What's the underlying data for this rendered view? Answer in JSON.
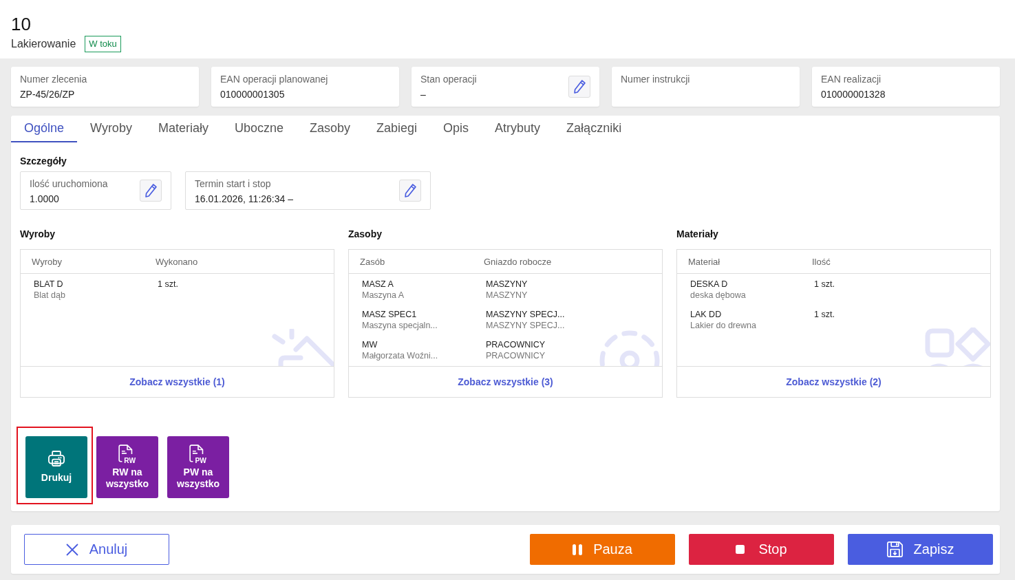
{
  "header": {
    "number": "10",
    "operation": "Lakierowanie",
    "status_badge": "W toku"
  },
  "info_fields": [
    {
      "label": "Numer zlecenia",
      "value": "ZP-45/26/ZP",
      "editable": false
    },
    {
      "label": "EAN operacji planowanej",
      "value": "010000001305",
      "editable": false
    },
    {
      "label": "Stan operacji",
      "value": "–",
      "editable": true
    },
    {
      "label": "Numer instrukcji",
      "editable": false
    },
    {
      "label": "EAN realizacji",
      "value": "010000001328",
      "editable": false
    }
  ],
  "tabs": [
    {
      "label": "Ogólne",
      "selected": true
    },
    {
      "label": "Wyroby",
      "selected": false
    },
    {
      "label": "Materiały",
      "selected": false
    },
    {
      "label": "Uboczne",
      "selected": false
    },
    {
      "label": "Zasoby",
      "selected": false
    },
    {
      "label": "Zabiegi",
      "selected": false
    },
    {
      "label": "Opis",
      "selected": false
    },
    {
      "label": "Atrybuty",
      "selected": false
    },
    {
      "label": "Załączniki",
      "selected": false
    }
  ],
  "details": {
    "title": "Szczegóły",
    "fields": [
      {
        "label": "Ilość uruchomiona",
        "value": "1.0000",
        "editable": true
      },
      {
        "label": "Termin start i stop",
        "value": "16.01.2026, 11:26:34 –",
        "editable": true
      }
    ]
  },
  "panels": [
    {
      "title": "Wyroby",
      "kind": "products",
      "columns": [
        "Wyroby",
        "Wykonano"
      ],
      "rows": [
        {
          "cells": [
            {
              "main": "BLAT D",
              "sub": "Blat dąb"
            },
            {
              "main": "1 szt."
            }
          ]
        }
      ],
      "link": "Zobacz wszystkie (1)"
    },
    {
      "title": "Zasoby",
      "kind": "resources",
      "columns": [
        "Zasób",
        "Gniazdo robocze"
      ],
      "rows": [
        {
          "cells": [
            {
              "main": "MASZ A",
              "sub": "Maszyna A"
            },
            {
              "main": "MASZYNY",
              "sub": "MASZYNY"
            }
          ]
        },
        {
          "cells": [
            {
              "main": "MASZ SPEC1",
              "sub": "Maszyna specjaln..."
            },
            {
              "main": "MASZYNY SPECJ...",
              "sub": "MASZYNY SPECJ..."
            }
          ]
        },
        {
          "cells": [
            {
              "main": "MW",
              "sub": "Małgorzata Woźni..."
            },
            {
              "main": "PRACOWNICY",
              "sub": "PRACOWNICY"
            }
          ]
        }
      ],
      "link": "Zobacz wszystkie (3)"
    },
    {
      "title": "Materiały",
      "kind": "materials",
      "columns": [
        "Materiał",
        "Ilość"
      ],
      "rows": [
        {
          "cells": [
            {
              "main": "DESKA D",
              "sub": "deska dębowa"
            },
            {
              "main": "1 szt."
            }
          ]
        },
        {
          "cells": [
            {
              "main": "LAK DD",
              "sub": "Lakier do drewna"
            },
            {
              "main": "1 szt."
            }
          ]
        }
      ],
      "link": "Zobacz wszystkie (2)"
    }
  ],
  "actions": [
    {
      "label": "Drukuj",
      "kind": "print",
      "highlighted": true
    },
    {
      "label": "RW na wszystko",
      "kind": "document",
      "icon_text": "RW",
      "highlighted": false
    },
    {
      "label": "PW na wszystko",
      "kind": "document",
      "icon_text": "PW",
      "highlighted": false
    }
  ],
  "footer_buttons": [
    {
      "label": "Anuluj",
      "kind": "cancel"
    },
    {
      "label": "Pauza",
      "kind": "pause"
    },
    {
      "label": "Stop",
      "kind": "stop"
    },
    {
      "label": "Zapisz",
      "kind": "save"
    }
  ]
}
